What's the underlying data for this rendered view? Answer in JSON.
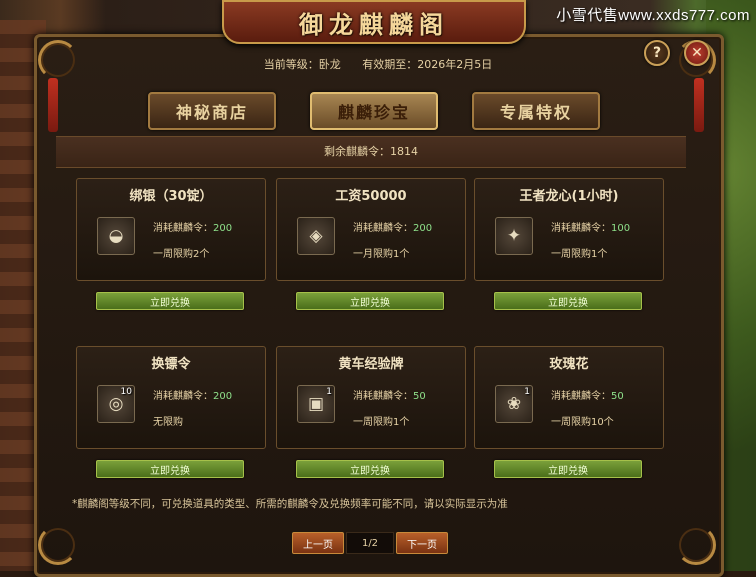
{
  "watermark": "小雪代售www.xxds777.com",
  "window": {
    "title": "御龙麒麟阁",
    "help_symbol": "?",
    "close_symbol": "✕"
  },
  "status": {
    "level_label": "当前等级：卧龙",
    "expiry_label": "有效期至：2026年2月5日"
  },
  "tabs": [
    {
      "label": "神秘商店",
      "active": false
    },
    {
      "label": "麒麟珍宝",
      "active": true
    },
    {
      "label": "专属特权",
      "active": false
    }
  ],
  "remaining": "剩余麒麟令：1814",
  "items": [
    {
      "name": "绑银（30锭）",
      "icon": "silver-ingot-icon",
      "glyph": "◒",
      "qty": "",
      "cost_label": "消耗麒麟令：",
      "cost": "200",
      "limit": "一周限购2个",
      "button": "立即兑换"
    },
    {
      "name": "工资50000",
      "icon": "gold-stack-icon",
      "glyph": "◈",
      "qty": "",
      "cost_label": "消耗麒麟令：",
      "cost": "200",
      "limit": "一月限购1个",
      "button": "立即兑换"
    },
    {
      "name": "王者龙心(1小时)",
      "icon": "dragon-heart-icon",
      "glyph": "✦",
      "qty": "",
      "cost_label": "消耗麒麟令：",
      "cost": "100",
      "limit": "一周限购1个",
      "button": "立即兑换"
    },
    {
      "name": "换镖令",
      "icon": "escort-token-icon",
      "glyph": "◎",
      "qty": "10",
      "cost_label": "消耗麒麟令：",
      "cost": "200",
      "limit": "无限购",
      "button": "立即兑换"
    },
    {
      "name": "黄车经验牌",
      "icon": "yellow-cart-icon",
      "glyph": "▣",
      "qty": "1",
      "cost_label": "消耗麒麟令：",
      "cost": "50",
      "limit": "一周限购1个",
      "button": "立即兑换"
    },
    {
      "name": "玫瑰花",
      "icon": "rose-icon",
      "glyph": "❀",
      "qty": "1",
      "cost_label": "消耗麒麟令：",
      "cost": "50",
      "limit": "一周限购10个",
      "button": "立即兑换"
    }
  ],
  "footnote": "*麒麟阁等级不同，可兑换道具的类型、所需的麒麟令及兑换频率可能不同，请以实际显示为准",
  "pager": {
    "prev": "上一页",
    "page": "1/2",
    "next": "下一页"
  }
}
